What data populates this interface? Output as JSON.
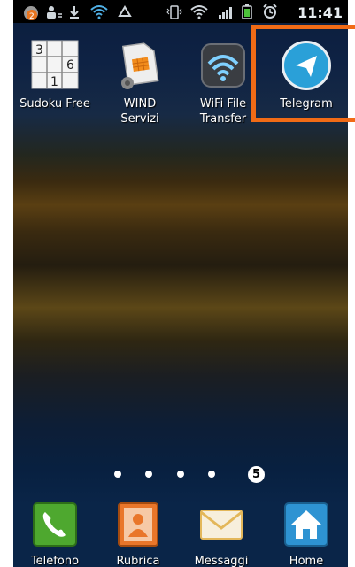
{
  "status_bar": {
    "time": "11:41",
    "notification_badge": "2",
    "icons": [
      "notification-icon",
      "user-sync-icon",
      "download-icon",
      "wifi-icon",
      "recycle-icon",
      "vibrate-icon",
      "wifi-signal-icon",
      "cell-signal-icon",
      "battery-icon",
      "alarm-icon"
    ]
  },
  "home_apps": [
    {
      "label": "Sudoku Free",
      "icon": "sudoku-icon"
    },
    {
      "label": "WIND\nServizi",
      "icon": "sim-card-icon"
    },
    {
      "label": "WiFi File\nTransfer",
      "icon": "wifi-transfer-icon"
    },
    {
      "label": "Telegram",
      "icon": "telegram-icon"
    }
  ],
  "sudoku_digits": [
    "3",
    "6",
    "1"
  ],
  "page_indicator": {
    "current_page": "5",
    "total_pages": 5
  },
  "dock": [
    {
      "label": "Telefono",
      "icon": "phone-icon"
    },
    {
      "label": "Rubrica",
      "icon": "contacts-icon"
    },
    {
      "label": "Messaggi",
      "icon": "messages-icon"
    },
    {
      "label": "Home",
      "icon": "home-icon"
    }
  ],
  "colors": {
    "highlight": "#f16b16",
    "telegram": "#2aa0d8"
  }
}
